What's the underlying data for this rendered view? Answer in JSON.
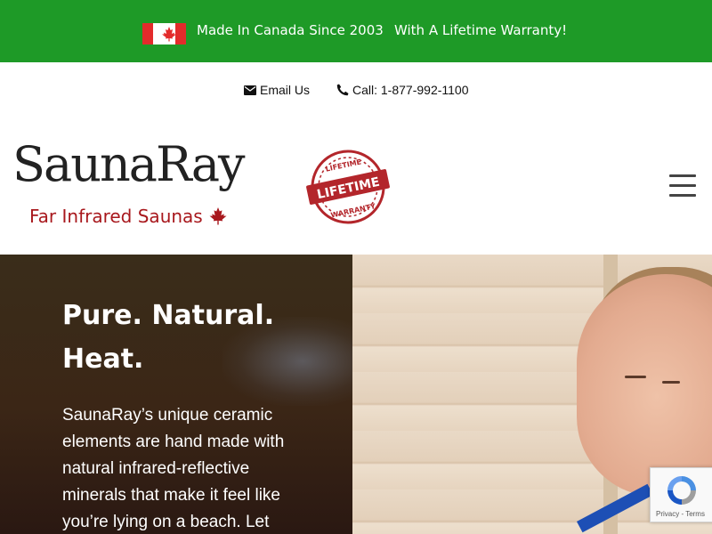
{
  "topbar": {
    "message_made": "Made In Canada Since 2003",
    "message_warranty": "With A Lifetime Warranty!",
    "bg_color": "#1e9a27"
  },
  "contact": {
    "email_label": "Email Us",
    "call_label": "Call: 1-877-992-1100"
  },
  "logo": {
    "brand": "SaunaRay",
    "tagline": "Far Infrared Saunas",
    "brand_color": "#a8181d"
  },
  "seal": {
    "top": "LIFETIME",
    "center": "LIFETIME",
    "bottom": "WARRANTY"
  },
  "hero": {
    "title_line1": "Pure. Natural.",
    "title_line2": "Heat.",
    "body": "SaunaRay’s unique ceramic elements are hand made with natural infrared-reflective minerals that make it feel like you’re lying on a beach. Let"
  },
  "recaptcha": {
    "links": "Privacy - Terms"
  }
}
